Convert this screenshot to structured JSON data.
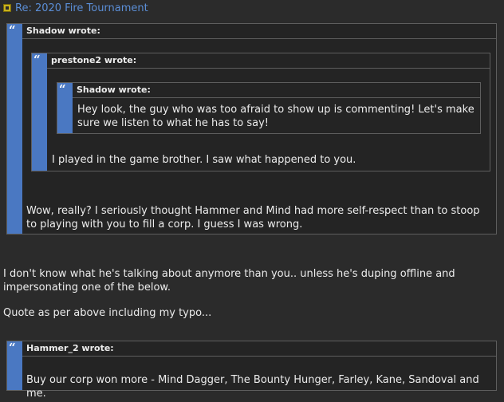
{
  "post": {
    "title": "Re: 2020 Fire Tournament"
  },
  "quote_outer": {
    "author": "Shadow wrote:",
    "text": "Wow, really? I seriously thought Hammer and Mind had more self-respect than to stoop to playing with you to fill a corp. I guess I was wrong."
  },
  "quote_middle": {
    "author": "prestone2 wrote:",
    "text": "I played in the game brother. I saw what happened to you."
  },
  "quote_inner": {
    "author": "Shadow wrote:",
    "text": "Hey look, the guy who was too afraid to show up is commenting! Let's make sure we listen to what he has to say!"
  },
  "reply": {
    "paragraph_1": "I don't know what he's talking about anymore than you.. unless he's duping offline and impersonating one of the below.",
    "paragraph_2": "Quote as per above including my typo..."
  },
  "quote_hammer": {
    "author": "Hammer_2 wrote:",
    "text": "Buy our corp won more - Mind Dagger, The Bounty Hunger, Farley, Kane, Sandoval and me."
  },
  "colors": {
    "background": "#2b2b2b",
    "quote_bar": "#4a78c2",
    "link": "#5b8ed6",
    "text": "#ececec"
  },
  "icons": {
    "post": "post-icon",
    "quote": "quote-icon"
  }
}
